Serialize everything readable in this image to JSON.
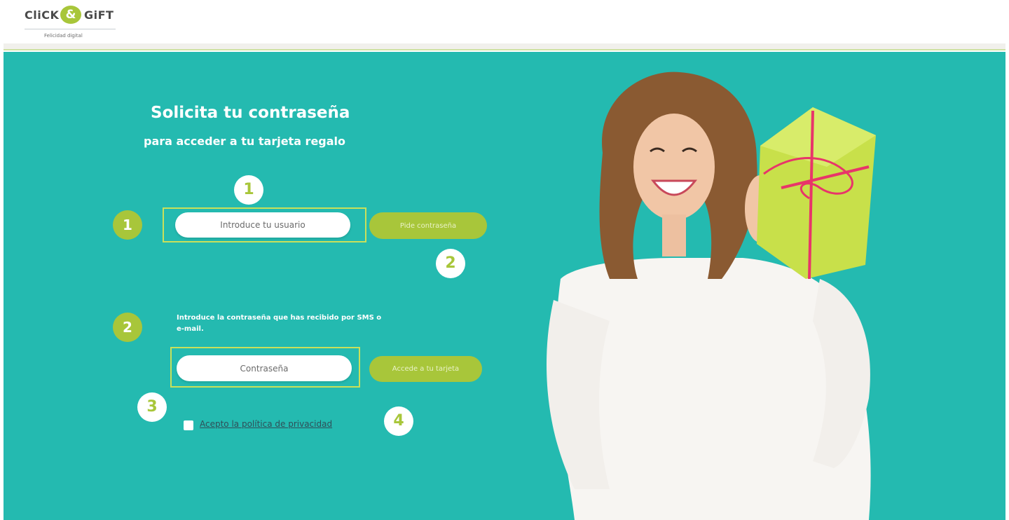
{
  "header": {
    "logo": {
      "word_left": "CliCK",
      "ampersand": "&",
      "word_right": "GiFT",
      "tagline": "Felicidad digital"
    }
  },
  "main": {
    "title": "Solicita tu contraseña",
    "subtitle": "para acceder a tu tarjeta regalo",
    "step1": {
      "badge": "1",
      "user_placeholder": "Introduce tu usuario",
      "button_label": "Pide contraseña"
    },
    "step2": {
      "badge": "2",
      "instruction": "Introduce la contraseña que has recibido por SMS o e-mail.",
      "password_placeholder": "Contraseña",
      "button_label": "Accede a tu tarjeta"
    },
    "privacy_label": "Acepto la política de privacidad",
    "callouts": [
      "1",
      "2",
      "3",
      "4"
    ]
  },
  "colors": {
    "teal_background": "#24bab0",
    "lime_accent": "#a8c63a",
    "highlight_frame": "#c9e05a",
    "gift_box": "#c8e04a",
    "ribbon": "#e8356a"
  },
  "icons": {
    "hero_image": "smiling-woman-holding-gift-illustration",
    "gift_box": "gift-box-icon"
  }
}
